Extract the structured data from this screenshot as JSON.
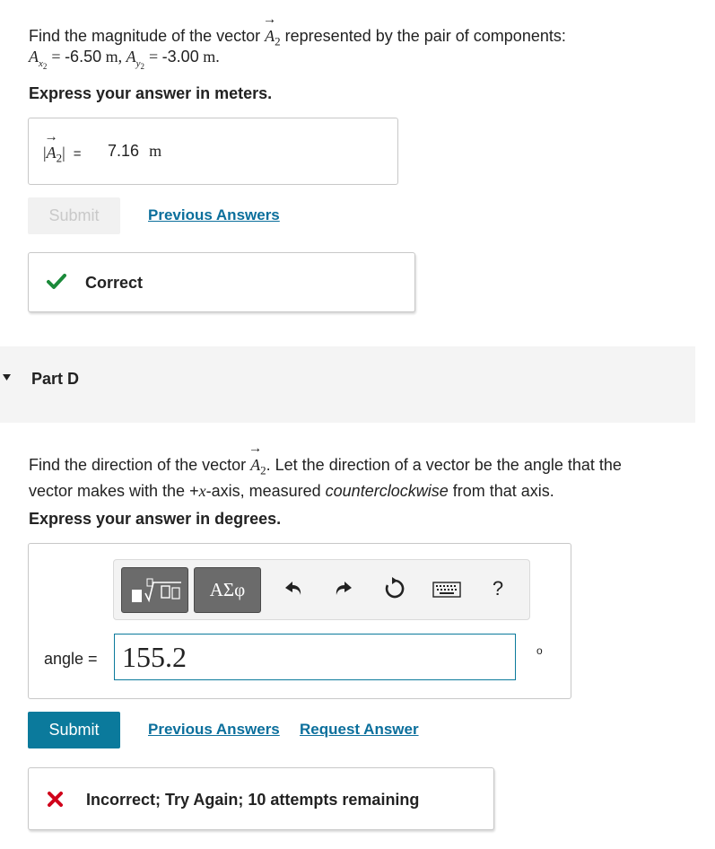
{
  "partC": {
    "question_prefix": "Find the magnitude of the vector ",
    "vector_symbol": "A",
    "vector_sub": "2",
    "question_suffix": " represented by the pair of components:",
    "component_x_label": "x",
    "component_x_value": "-6.50",
    "component_y_label": "y",
    "component_y_value": "-3.00",
    "unit": "m",
    "instruction": "Express your answer in meters.",
    "answer_value": "7.16",
    "answer_unit": "m",
    "submit_label": "Submit",
    "previous_answers_label": "Previous Answers",
    "feedback": "Correct"
  },
  "partD": {
    "header": "Part D",
    "question_prefix": "Find the direction of the vector ",
    "vector_symbol": "A",
    "vector_sub": "2",
    "question_mid": ". Let the direction of a vector be the angle that the",
    "question_line2_a": "vector makes with the +",
    "question_line2_x": "x",
    "question_line2_b": "-axis, measured ",
    "question_line2_em": "counterclockwise",
    "question_line2_c": " from that axis.",
    "instruction": "Express your answer in degrees.",
    "greek_label": "ΑΣφ",
    "help_label": "?",
    "input_label": "angle =",
    "input_value": "155.2",
    "unit_symbol": "o",
    "submit_label": "Submit",
    "previous_answers_label": "Previous Answers",
    "request_answer_label": "Request Answer",
    "feedback": "Incorrect; Try Again; 10 attempts remaining"
  },
  "colors": {
    "accent": "#0b7a9c",
    "correct": "#1b8a3a",
    "incorrect": "#d0021b",
    "part_header_bg": "#f4f4f4"
  },
  "icons": [
    "check-icon",
    "cross-icon",
    "templates-icon",
    "greek-icon",
    "undo-icon",
    "redo-icon",
    "reset-icon",
    "keyboard-icon",
    "help-icon",
    "collapse-triangle-icon"
  ]
}
